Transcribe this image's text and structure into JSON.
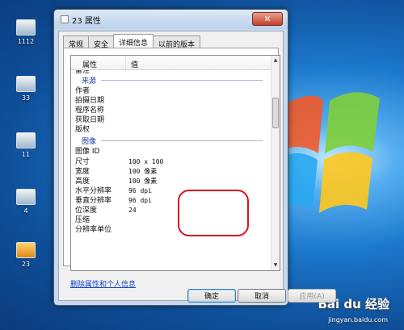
{
  "desktop": {
    "icons": [
      {
        "label": "1112"
      },
      {
        "label": "33"
      },
      {
        "label": "11"
      },
      {
        "label": "4"
      },
      {
        "label": "23"
      }
    ],
    "watermark": "Bai du 经验",
    "watermark_url": "jingyan.baidu.com"
  },
  "dialog": {
    "title": "23 属性",
    "close_glyph": "✕",
    "tabs": [
      {
        "label": "常规"
      },
      {
        "label": "安全"
      },
      {
        "label": "详细信息",
        "active": true
      },
      {
        "label": "以前的版本"
      }
    ],
    "list": {
      "col_property": "属性",
      "col_value": "值",
      "cut_row": "备注",
      "section_origin": "来源",
      "origin_rows": [
        {
          "p": "作者",
          "v": ""
        },
        {
          "p": "拍摄日期",
          "v": ""
        },
        {
          "p": "程序名称",
          "v": ""
        },
        {
          "p": "获取日期",
          "v": ""
        },
        {
          "p": "版权",
          "v": ""
        }
      ],
      "section_image": "图像",
      "image_rows": [
        {
          "p": "图像 ID",
          "v": ""
        },
        {
          "p": "尺寸",
          "v": "100 x 100"
        },
        {
          "p": "宽度",
          "v": "100 像素"
        },
        {
          "p": "高度",
          "v": "100 像素"
        },
        {
          "p": "水平分辨率",
          "v": "96 dpi"
        },
        {
          "p": "垂直分辨率",
          "v": "96 dpi"
        },
        {
          "p": "位深度",
          "v": "24"
        },
        {
          "p": "压缩",
          "v": ""
        },
        {
          "p": "分辨率单位",
          "v": ""
        }
      ]
    },
    "remove_link": "删除属性和个人信息",
    "buttons": {
      "ok": "确定",
      "cancel": "取消",
      "apply": "应用(A)"
    }
  },
  "colors": {
    "accent_red": "#d8141c",
    "link": "#1545c4",
    "section": "#1a3d9c"
  }
}
